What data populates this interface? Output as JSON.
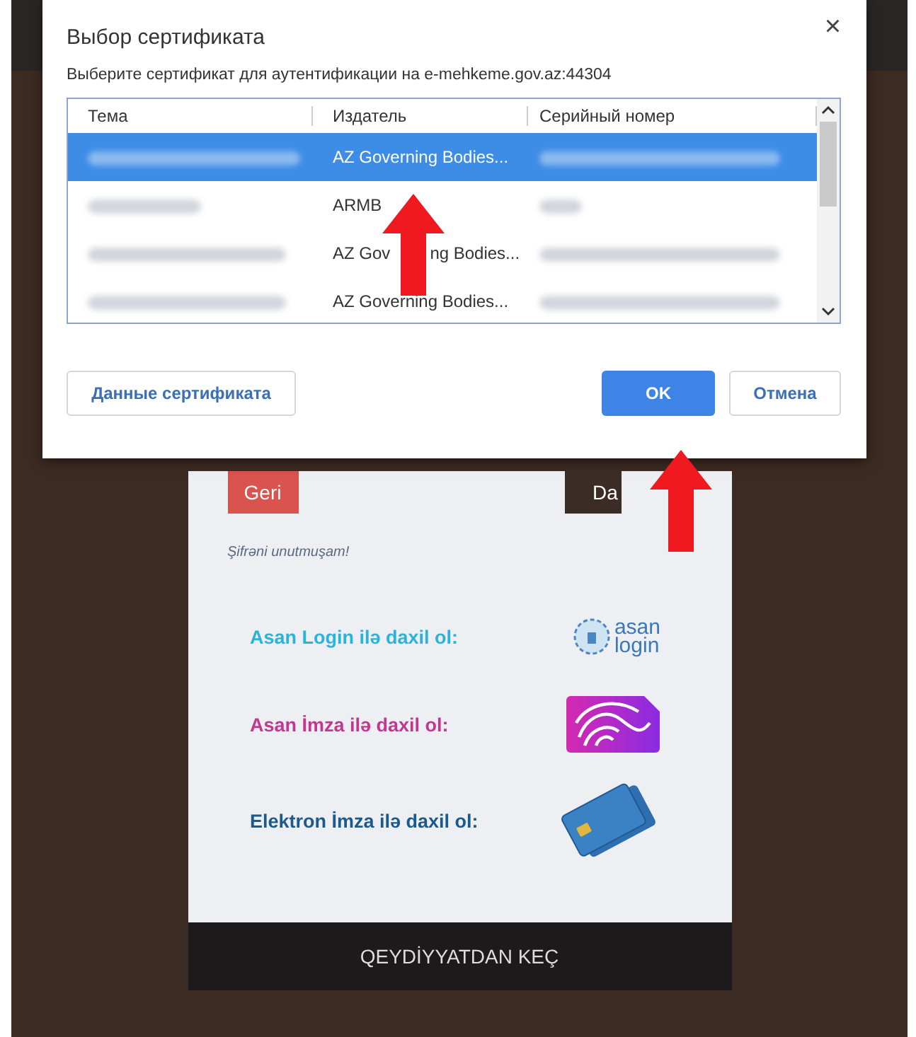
{
  "dialog": {
    "title": "Выбор сертификата",
    "close": "×",
    "message": "Выберите сертификат для аутентификации на e-mehkeme.gov.az:44304",
    "table": {
      "columns": [
        "Тема",
        "Издатель",
        "Серийный номер"
      ],
      "rows": [
        {
          "issuer": "AZ Governing Bodies...",
          "selected": true
        },
        {
          "issuer": "ARMB",
          "selected": false
        },
        {
          "issuer_parts": [
            "AZ Gov",
            "ng Bodies..."
          ],
          "selected": false
        },
        {
          "issuer": "AZ Governing Bodies...",
          "selected": false
        }
      ]
    },
    "buttons": [
      {
        "label": "Данные сертификата",
        "kind": "secondary"
      },
      {
        "label": "OK",
        "kind": "primary"
      },
      {
        "label": "Отмена",
        "kind": "secondary"
      }
    ]
  },
  "login": {
    "back_button": "Geri",
    "submit_button": "Da",
    "forgot_link": "Şifrəni unutmuşam!",
    "methods": [
      {
        "label": "Asan Login ilə daxil ol:",
        "color": "#2bb3d9",
        "kind": "asan-login",
        "logo_text": [
          "asan",
          "login"
        ]
      },
      {
        "label": "Asan İmza ilə daxil ol:",
        "color": "#c2388f",
        "kind": "asan-imza"
      },
      {
        "label": "Elektron İmza ilə daxil ol:",
        "color": "#1b5a8a",
        "kind": "card"
      }
    ],
    "register_button": "QEYDİYYATDAN KEÇ"
  }
}
